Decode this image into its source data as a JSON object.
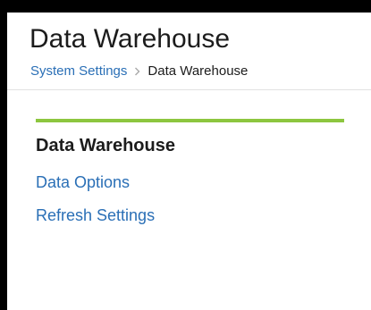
{
  "header": {
    "title": "Data Warehouse",
    "breadcrumb": {
      "parent": "System Settings",
      "current": "Data Warehouse"
    }
  },
  "panel": {
    "title": "Data Warehouse",
    "links": [
      {
        "label": "Data Options"
      },
      {
        "label": "Refresh Settings"
      }
    ]
  },
  "colors": {
    "accent": "#8dc63f",
    "link": "#2a6fb6",
    "text": "#1c1c1c",
    "frame": "#000000"
  }
}
